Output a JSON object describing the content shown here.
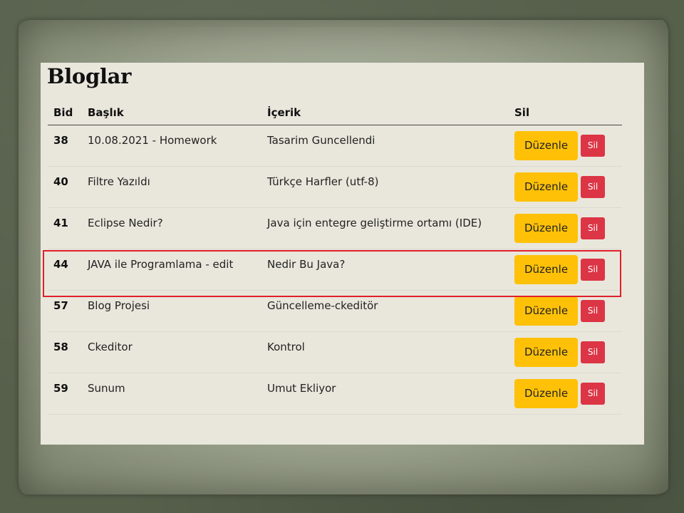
{
  "page": {
    "title": "Bloglar"
  },
  "table": {
    "headers": [
      "Bid",
      "Başlık",
      "İçerik",
      "Sil"
    ],
    "rows": [
      {
        "bid": "38",
        "title": "10.08.2021 - Homework",
        "content": "Tasarim Guncellendi"
      },
      {
        "bid": "40",
        "title": "Filtre Yazıldı",
        "content": "Türkçe Harfler (utf-8)"
      },
      {
        "bid": "41",
        "title": "Eclipse Nedir?",
        "content": "Java için entegre geliştirme ortamı (IDE)"
      },
      {
        "bid": "44",
        "title": "JAVA ile Programlama - edit",
        "content": "Nedir Bu Java?"
      },
      {
        "bid": "57",
        "title": "Blog Projesi",
        "content": "Güncelleme-ckeditör"
      },
      {
        "bid": "58",
        "title": "Ckeditor",
        "content": "Kontrol"
      },
      {
        "bid": "59",
        "title": "Sunum",
        "content": "Umut Ekliyor"
      }
    ],
    "edit_label": "Düzenle",
    "delete_label": "Sil"
  },
  "colors": {
    "edit_button": "#ffc107",
    "delete_button": "#dc3545",
    "highlight_border": "#e0202a"
  }
}
